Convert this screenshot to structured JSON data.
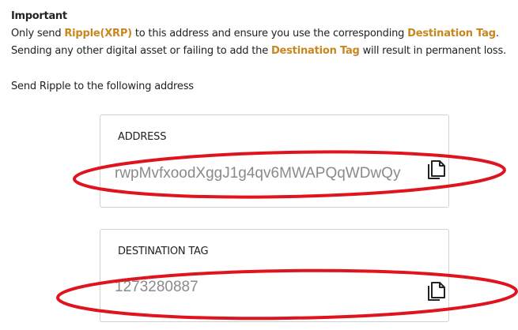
{
  "notice": {
    "title": "Important",
    "line1_pre": "Only send ",
    "line1_asset": "Ripple(XRP)",
    "line1_mid": " to this address and ensure you use the corresponding ",
    "line1_tag": "Destination Tag",
    "line1_end": ".",
    "line2_pre": "Sending any other digital asset or failing to add the ",
    "line2_tag": "Destination Tag",
    "line2_end": " will result in permanent loss."
  },
  "send_label": "Send Ripple to the following address",
  "address_card": {
    "label": "ADDRESS",
    "value": "rwpMvfxoodXggJ1g4qv6MWAPQqWDwQy",
    "copy_icon": "copy-icon"
  },
  "tag_card": {
    "label": "DESTINATION TAG",
    "value": "1273280887",
    "copy_icon": "copy-icon"
  },
  "colors": {
    "highlight": "#c8861e",
    "annotation": "#e0141e",
    "value_text": "#8a8a8a"
  }
}
